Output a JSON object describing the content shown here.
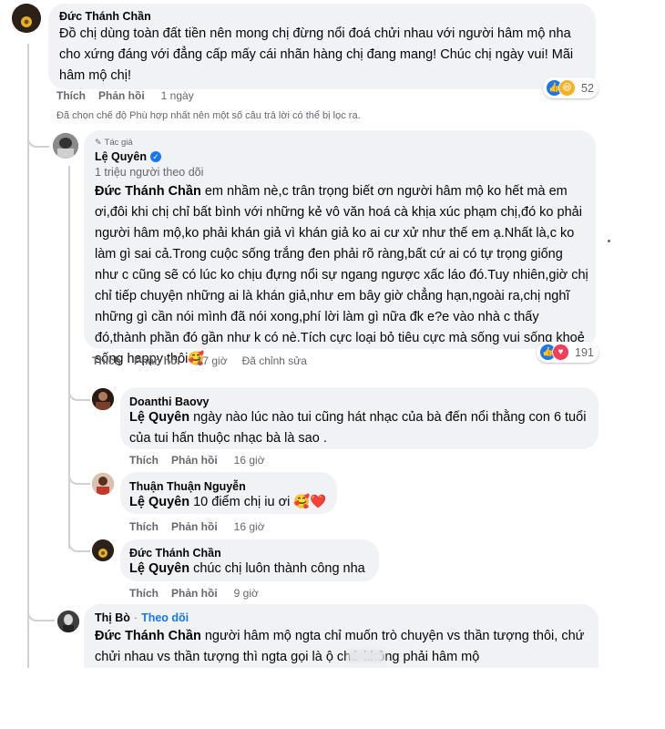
{
  "comments": {
    "c1": {
      "author": "Đức Thánh Chần",
      "text": "Đồ chị dùng toàn đất tiền nên mong chị đừng nổi đoá chửi nhau với người hâm mộ nha cho xứng đáng với đẳng cấp mấy cái nhãn hàng chị đang mang! Chúc chị ngày vui! Mãi hâm mộ chị!",
      "like": "Thích",
      "reply": "Phản hồi",
      "time": "1 ngày",
      "reactions": "52"
    },
    "filter_note": "Đã chọn chế độ Phù hợp nhất nên một số câu trả lời có thể bị lọc ra.",
    "c2": {
      "badge": "Tác giả",
      "author": "Lệ Quyên",
      "followers": "1 triệu người theo dõi",
      "tag": "Đức Thánh Chần",
      "text": " em nhầm nè,c trân trọng biết ơn người hâm mộ ko hết mà em ơi,đôi khi chị chỉ bất bình với những kẻ vô văn hoá cà khịa xúc phạm chị,đó ko phải người hâm mộ,ko phải khán giả vì khán giả ko ai cư xử như thế em ạ.Nhất là,c ko làm gì sai cả.Trong cuộc sống trắng đen phải rõ ràng,bất cứ ai có tự trọng giống như c cũng sẽ có lúc ko chịu đựng nổi sự ngang ngược xấc láo đó.Tuy nhiên,giờ chị chỉ tiếp chuyện những ai là khán giả,như em bây giờ chẳng hạn,ngoài ra,chị nghĩ những gì cần nói mình đã nói xong,phí lời làm gì nữa đk e?e vào nhà c thấy đó,thành phần đó gần như k có nè.Tích cực loại bỏ tiêu cực mà sống vui sống khoẻ sống happy thôi🥰",
      "like": "Thích",
      "reply": "Phản hồi",
      "time": "17 giờ",
      "edited": "Đã chỉnh sửa",
      "reactions": "191"
    },
    "c3": {
      "author": "Doanthi Baovy",
      "tag": "Lệ Quyên",
      "text": " ngày nào lúc nào tui cũng hát nhạc của bà đến nổi thằng con 6 tuổi của tui hấn thuộc nhạc bà là sao .",
      "like": "Thích",
      "reply": "Phản hồi",
      "time": "16 giờ"
    },
    "c4": {
      "author": "Thuận Thuận Nguyễn",
      "tag": "Lệ Quyên",
      "text": " 10 điểm chị iu ơi 🥰❤️",
      "like": "Thích",
      "reply": "Phản hồi",
      "time": "16 giờ"
    },
    "c5": {
      "author": "Đức Thánh Chần",
      "tag": "Lệ Quyên",
      "text": " chúc chị luôn thành công nha",
      "like": "Thích",
      "reply": "Phản hồi",
      "time": "9 giờ"
    },
    "c6": {
      "author": "Thị Bò",
      "separator": "·",
      "follow": "Theo dõi",
      "tag": "Đức Thánh Chần",
      "text": " người hâm mộ ngta chỉ muốn trò chuyện vs thần tượng thôi, chứ chửi nhau vs thần tượng thì ngta gọi là        ộ chứ không phải hâm mộ"
    }
  },
  "colors": {
    "bubble": "#f0f2f5",
    "link": "#1877f2",
    "secondary_text": "#65676b",
    "verified": "#1877f2"
  },
  "icons": [
    "verified-badge-icon",
    "like-reaction-icon",
    "haha-reaction-icon",
    "love-reaction-icon"
  ]
}
